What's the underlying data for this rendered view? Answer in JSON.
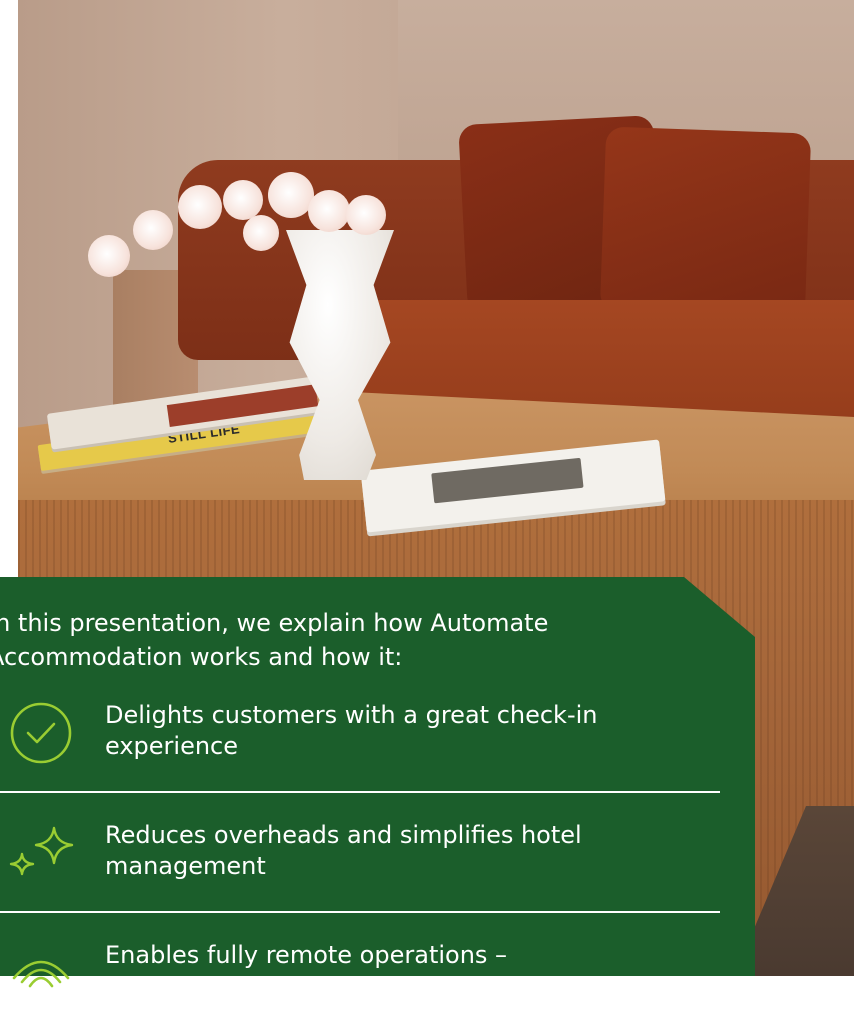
{
  "hero": {
    "book_spine_text": "STILL LIFE",
    "alt": "Living room with orange sofa, wooden table, books and white vase with orchids"
  },
  "intro": {
    "text": "In this presentation, we explain how Automate Accommodation works and how it:"
  },
  "features": [
    {
      "icon": "check-circle-icon",
      "text": "Delights customers with a great check-in experience"
    },
    {
      "icon": "sparkle-icon",
      "text": "Reduces overheads and simplifies hotel management"
    },
    {
      "icon": "signal-waves-icon",
      "text": "Enables fully remote operations –"
    }
  ],
  "colors": {
    "card_bg": "#1b5e2b",
    "icon_accent": "#9acd32",
    "text": "#ffffff"
  }
}
